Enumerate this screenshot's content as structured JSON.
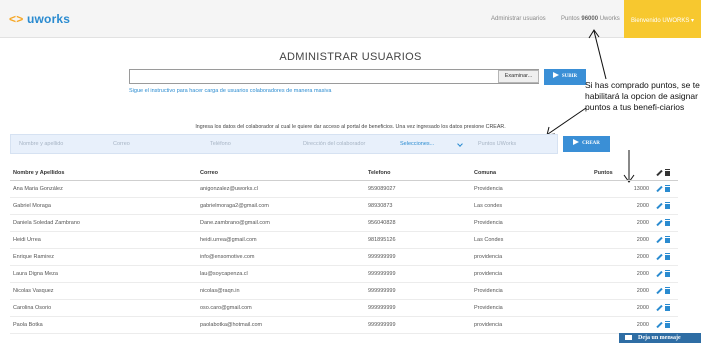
{
  "topbar": {
    "logo_bracket": "<>",
    "logo_text": "uworks",
    "nav_admin": "Administrar usuarios",
    "points_label": "Puntos",
    "points_value": "96000",
    "points_suffix": "Uworks",
    "welcome": "Bienvenido UWORKS ▾"
  },
  "page": {
    "title": "ADMINISTRAR USUARIOS"
  },
  "upload": {
    "browse_label": "Examinar...",
    "upload_label": "SUBIR",
    "instructions_link": "Sigue el instructivo para hacer carga de usuarios colaboradores de manera masiva"
  },
  "annotation": {
    "text": "Si has comprado puntos, se te habilitará la opcion de asignar puntos a tus benefi-ciarios"
  },
  "info_text": "Ingresa los datos del colaborador al cual le quiere dar acceso al portal de beneficios. Una vez ingresado los datos presione CREAR.",
  "form": {
    "name_placeholder": "Nombre y apellido",
    "email_placeholder": "Correo",
    "phone_placeholder": "Teléfono",
    "address_placeholder": "Dirección del colaborador",
    "select_value": "Selecciones...",
    "points_placeholder": "Puntos UWorks",
    "create_label": "CREAR"
  },
  "table": {
    "headers": {
      "name": "Nombre y Apellidos",
      "email": "Correo",
      "phone": "Telefono",
      "comuna": "Comuna",
      "points": "Puntos"
    },
    "rows": [
      {
        "name": "Ana Maria González",
        "email": "anigonzalez@uworks.cl",
        "phone": "959089027",
        "comuna": "Providencia",
        "points": "13000"
      },
      {
        "name": "Gabriel Moraga",
        "email": "gabrielmoraga2@gmail.com",
        "phone": "98930873",
        "comuna": "Las condes",
        "points": "2000"
      },
      {
        "name": "Daniela Soledad Zambrano",
        "email": "Dane.zambrano@gmail.com",
        "phone": "956040828",
        "comuna": "Providencia",
        "points": "2000"
      },
      {
        "name": "Heidi Urrea",
        "email": "heidi.urrea@gmail.com",
        "phone": "981895126",
        "comuna": "Las Condes",
        "points": "2000"
      },
      {
        "name": "Enrique Ramirez",
        "email": "info@ensomotive.com",
        "phone": "999999999",
        "comuna": "providencia",
        "points": "2000"
      },
      {
        "name": "Laura Digna Meza",
        "email": "lau@soycapenza.cl",
        "phone": "999999999",
        "comuna": "providencia",
        "points": "2000"
      },
      {
        "name": "Nicolas Vasquez",
        "email": "nicolas@raqn.in",
        "phone": "999999999",
        "comuna": "Providencia",
        "points": "2000"
      },
      {
        "name": "Carolina Osorio",
        "email": "oso.caro@gmail.com",
        "phone": "999999999",
        "comuna": "Providencia",
        "points": "2000"
      },
      {
        "name": "Paola Botka",
        "email": "paolabotka@hotmail.com",
        "phone": "999999999",
        "comuna": "providencia",
        "points": "2000"
      }
    ]
  },
  "chat": {
    "label": "Deja un mensaje"
  }
}
